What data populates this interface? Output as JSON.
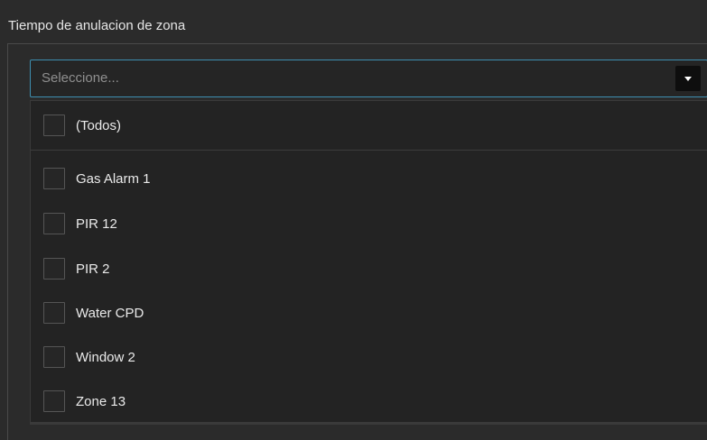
{
  "panel": {
    "title": "Tiempo de anulacion de zona"
  },
  "select": {
    "placeholder": "Seleccione...",
    "button_icon": "caret-down-icon"
  },
  "dropdown": {
    "select_all_label": "(Todos)",
    "options": [
      {
        "label": "Gas Alarm 1",
        "checked": false
      },
      {
        "label": "PIR 12",
        "checked": false
      },
      {
        "label": "PIR 2",
        "checked": false
      },
      {
        "label": "Water CPD",
        "checked": false
      },
      {
        "label": "Window 2",
        "checked": false
      },
      {
        "label": "Zone 13",
        "checked": false
      }
    ]
  },
  "colors": {
    "background": "#2b2b2b",
    "focus_border": "#3e8fb0",
    "text": "#eaeaea",
    "placeholder": "#8f8f8f"
  }
}
